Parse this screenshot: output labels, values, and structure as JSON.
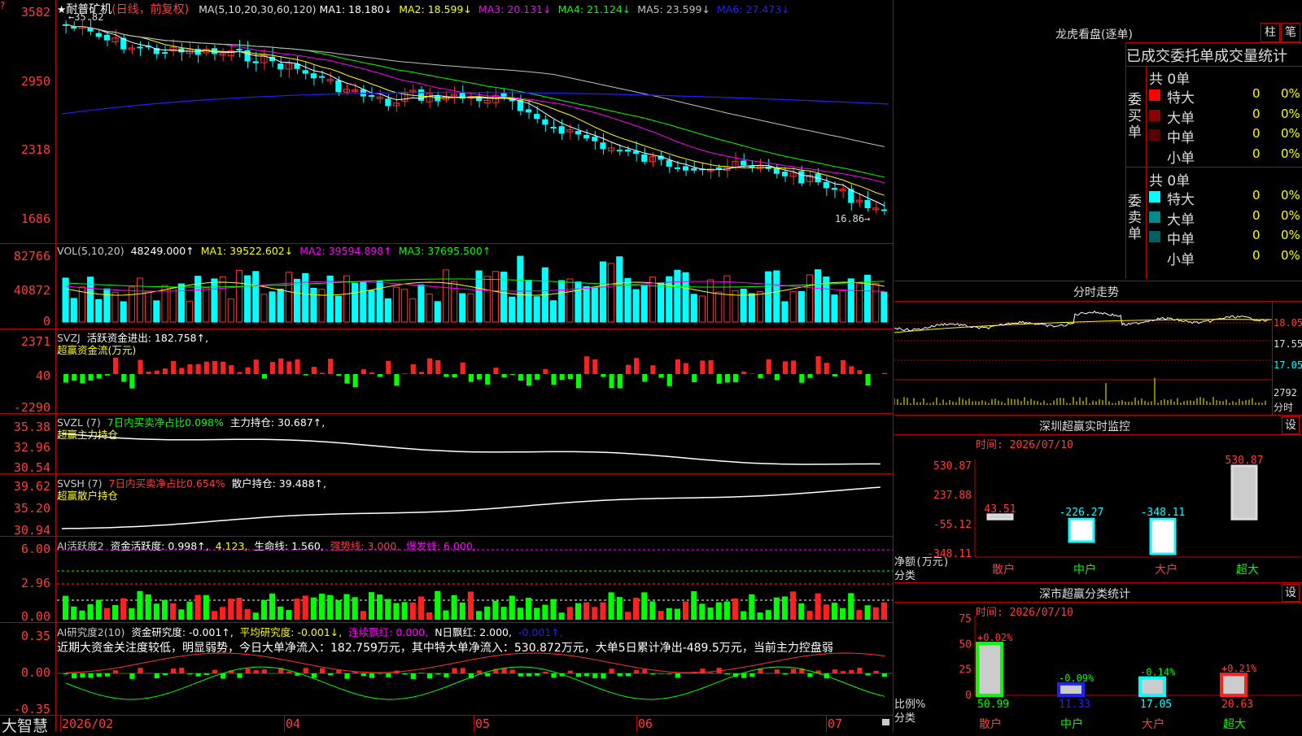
{
  "stock": {
    "name": "耐普矿机",
    "period": "(日线，前复权)",
    "title_star": "★",
    "high_label": "35.82",
    "low_label": "16.86"
  },
  "main_header": {
    "ma_params": "MA(5,10,20,30,60,120)",
    "items": [
      {
        "text": "MA1: 18.180↓",
        "color": "#ffffff"
      },
      {
        "text": "MA2: 18.599↓",
        "color": "#ffff00"
      },
      {
        "text": "MA3: 20.131↓",
        "color": "#ff00ff"
      },
      {
        "text": "MA4: 21.124↓",
        "color": "#00ff00"
      },
      {
        "text": "MA5: 23.599↓",
        "color": "#c0c0c0"
      },
      {
        "text": "MA6: 27.473↓",
        "color": "#2020ff"
      }
    ]
  },
  "y_labels": {
    "price": [
      "3582",
      "2950",
      "2318",
      "1686"
    ],
    "vol": [
      "82766",
      "40872",
      "0"
    ],
    "svzj": [
      "2371",
      "40",
      "-2290"
    ],
    "svzl": [
      "35.38",
      "32.96",
      "30.54"
    ],
    "svsh": [
      "39.62",
      "35.20",
      "30.94"
    ],
    "ai_active": [
      "6.00",
      "2.96",
      "0.00"
    ],
    "ai_research": [
      "0.35",
      "0.00",
      "-0.35"
    ]
  },
  "vol_header": [
    {
      "text": "VOL(5,10,20)",
      "color": "#cccccc"
    },
    {
      "text": "48249.000↑",
      "color": "#ffffff"
    },
    {
      "text": "MA1: 39522.602↓",
      "color": "#ffff00"
    },
    {
      "text": "MA2: 39594.898↑",
      "color": "#ff00ff"
    },
    {
      "text": "MA3: 37695.500↑",
      "color": "#00ff00"
    }
  ],
  "svzj_header": {
    "line1": [
      {
        "text": "SVZJ",
        "color": "#cccccc"
      },
      {
        "text": "活跃资金进出: 182.758↑,",
        "color": "#ffffff"
      }
    ],
    "line2": "超赢资金流(万元)"
  },
  "svzl_header": {
    "line1": [
      {
        "text": "SVZL (7)",
        "color": "#cccccc"
      },
      {
        "text": "7日内买卖净占比0.098%",
        "color": "#00ff00"
      },
      {
        "text": "主力持仓: 30.687↑,",
        "color": "#ffffff"
      }
    ],
    "line2": "超赢主力持仓"
  },
  "svsh_header": {
    "line1": [
      {
        "text": "SVSH (7)",
        "color": "#cccccc"
      },
      {
        "text": "7日内买卖净占比0.654%",
        "color": "#ff3b3b"
      },
      {
        "text": "散户持仓: 39.488↑,",
        "color": "#ffffff"
      }
    ],
    "line2": "超赢散户持仓"
  },
  "ai_active_header": [
    {
      "text": "AI活跃度2",
      "color": "#cccccc"
    },
    {
      "text": "资金活跃度: 0.998↑,",
      "color": "#ffffff"
    },
    {
      "text": "4.123,",
      "color": "#ffff00"
    },
    {
      "text": "生命线: 1.560,",
      "color": "#ffffff"
    },
    {
      "text": "强势线: 3.000,",
      "color": "#ff3b3b"
    },
    {
      "text": "爆发线: 6.000,",
      "color": "#ff00ff"
    }
  ],
  "ai_research_header": [
    {
      "text": "AI研究度2(10)",
      "color": "#cccccc"
    },
    {
      "text": "资金研究度: -0.001↑,",
      "color": "#ffffff"
    },
    {
      "text": "平均研究度: -0.001↓,",
      "color": "#ffff00"
    },
    {
      "text": "连续飘红: 0.000,",
      "color": "#ff00ff"
    },
    {
      "text": "N日飘红: 2.000,",
      "color": "#ffffff"
    },
    {
      "text": "-0.001↑,",
      "color": "#2020ff"
    }
  ],
  "ai_research_summary": "近期大资金关注度较低，明显弱势，今日大单净流入：182.759万元，其中特大单净流入：530.872万元，大单5日累计净出-489.5万元，当前主力控盘弱",
  "x_labels": [
    "2026/02",
    "04",
    "05",
    "06",
    "07"
  ],
  "brand": "大智慧",
  "dragon_tiger": {
    "title": "龙虎看盘(逐单)",
    "btn_zhu": "柱",
    "btn_bi": "笔"
  },
  "order_stats": {
    "title": "已成交委托单成交量统计",
    "buy": {
      "side_label": "委买单",
      "total": "共 0单",
      "rows": [
        {
          "name": "特大",
          "count": "0",
          "pct": "0%",
          "color": "#ff0000"
        },
        {
          "name": "大单",
          "count": "0",
          "pct": "0%",
          "color": "#8b0000"
        },
        {
          "name": "中单",
          "count": "0",
          "pct": "0%",
          "color": "#5a0000"
        },
        {
          "name": "小单",
          "count": "0",
          "pct": "0%",
          "color": "#000000"
        }
      ]
    },
    "sell": {
      "side_label": "委卖单",
      "total": "共 0单",
      "rows": [
        {
          "name": "特大",
          "count": "0",
          "pct": "0%",
          "color": "#00ffff"
        },
        {
          "name": "大单",
          "count": "0",
          "pct": "0%",
          "color": "#008b8b"
        },
        {
          "name": "中单",
          "count": "0",
          "pct": "0%",
          "color": "#006060"
        },
        {
          "name": "小单",
          "count": "0",
          "pct": "0%",
          "color": "#000000"
        }
      ]
    }
  },
  "intraday": {
    "title": "分时走势",
    "prices": [
      "18.05",
      "17.55",
      "17.05"
    ],
    "vol_label": "2792",
    "time_label": "分时"
  },
  "sz_monitor": {
    "title": "深圳超赢实时监控",
    "settings_btn": "设",
    "time": "时间: 2026/07/10",
    "y_labels": [
      "530.87",
      "237.88",
      "-55.12",
      "-348.11"
    ],
    "y_title": "净额(万元)",
    "x_title": "分类",
    "categories": [
      "散户",
      "中户",
      "大户",
      "超大"
    ],
    "value_labels": [
      "43.51",
      "-226.27",
      "-348.11",
      "530.87"
    ],
    "values": [
      43.51,
      -226.27,
      -348.11,
      530.87
    ]
  },
  "sz_class": {
    "title": "深市超赢分类统计",
    "settings_btn": "设",
    "time": "时间: 2026/07/10",
    "y_labels": [
      "75",
      "50",
      "25",
      "0"
    ],
    "y_title": "比例%",
    "x_title": "分类",
    "categories": [
      "散户",
      "中户",
      "大户",
      "超大"
    ],
    "values": [
      50.99,
      11.33,
      17.05,
      20.63
    ],
    "value_labels": [
      "50.99",
      "11.33",
      "17.05",
      "20.63"
    ],
    "delta_labels": [
      "+0.02%",
      "-0.09%",
      "-0.14%",
      "+0.21%"
    ]
  }
}
